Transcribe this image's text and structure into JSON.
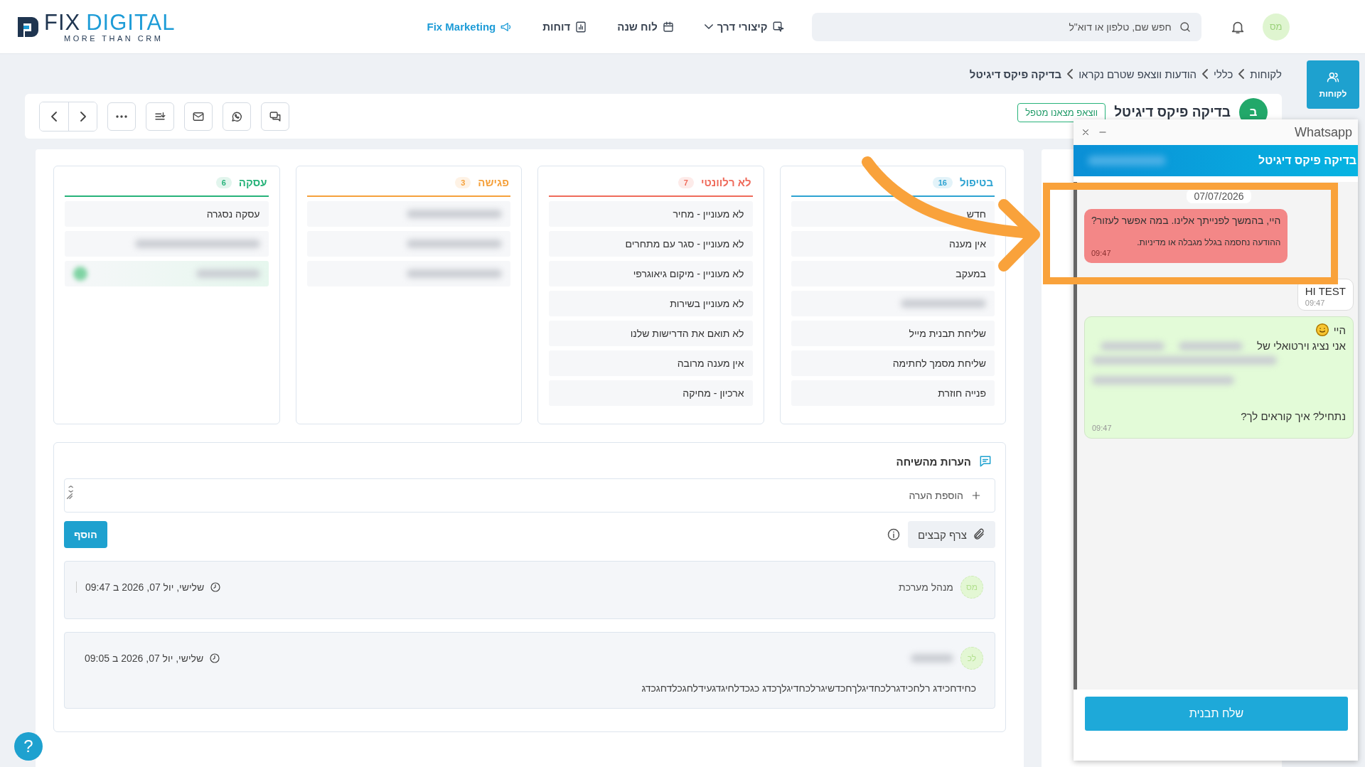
{
  "header": {
    "brand_primary": "FIX",
    "brand_secondary": "DIGITAL",
    "tagline": "MORE THAN CRM",
    "nav": [
      {
        "label": "קיצורי דרך",
        "kind": "shortcuts"
      },
      {
        "label": "לוח שנה",
        "kind": "calendar"
      },
      {
        "label": "דוחות",
        "kind": "reports"
      },
      {
        "label": "Fix Marketing",
        "kind": "marketing"
      }
    ],
    "search": {
      "placeholder": "חפש שם, טלפון או דוא\"ל"
    },
    "user_avatar": "מס"
  },
  "rail": [
    {
      "label": "לקוחות",
      "selected": true
    }
  ],
  "breadcrumb": [
    "לקוחות",
    "כללי",
    "הודעות ווצאפ שטרם נקראו",
    "בדיקה פיקס דיגיטל"
  ],
  "record": {
    "avatar": "ב",
    "name": "בדיקה פיקס דיגיטל",
    "tag": "ווצאפ מצאנו מטפל"
  },
  "pipeline": [
    {
      "title": "בטיפול",
      "count": "16",
      "color": "#2ea3d2",
      "items": [
        {
          "kind": "stage",
          "label": "חדש"
        },
        {
          "kind": "stage",
          "label": "אין מענה"
        },
        {
          "kind": "stage",
          "label": "במעקב"
        },
        {
          "kind": "blurred"
        },
        {
          "kind": "stage",
          "label": "שליחת תבנית מייל"
        },
        {
          "kind": "stage",
          "label": "שליחת מסמך לחתימה"
        },
        {
          "kind": "stage",
          "label": "פנייה חוזרת"
        }
      ]
    },
    {
      "title": "לא רלוונטי",
      "count": "7",
      "color": "#ef6b5b",
      "items": [
        {
          "kind": "stage",
          "label": "לא מעוניין - מחיר"
        },
        {
          "kind": "stage",
          "label": "לא מעוניין - סגר עם מתחרים"
        },
        {
          "kind": "stage",
          "label": "לא מעוניין - מיקום גיאוגרפי"
        },
        {
          "kind": "stage",
          "label": "לא מעוניין בשירות"
        },
        {
          "kind": "stage",
          "label": "לא תואם את הדרישות שלנו"
        },
        {
          "kind": "stage",
          "label": "אין מענה מרובה"
        },
        {
          "kind": "stage",
          "label": "ארכיון - מחיקה"
        }
      ]
    },
    {
      "title": "פגישה",
      "count": "3",
      "color": "#f5a13c",
      "items": [
        {
          "kind": "blurred"
        },
        {
          "kind": "blurred"
        },
        {
          "kind": "blurred"
        }
      ]
    },
    {
      "title": "עסקה",
      "count": "6",
      "color": "#27b37a",
      "items": [
        {
          "kind": "stage",
          "label": "עסקה נסגרה"
        },
        {
          "kind": "blurred"
        },
        {
          "kind": "blurred_marked"
        }
      ]
    }
  ],
  "notes": {
    "title": "הערות מהשיחה",
    "input": {
      "placeholder": "הוספת הערה"
    },
    "attach": "צרף קבצים",
    "add": "הוסף",
    "entries": [
      {
        "avatar": "מס",
        "author": "מנהל מערכת",
        "author_blurred": false,
        "date": "שלישי, יול 07, 2026 ב 09:47"
      },
      {
        "avatar": "לכ",
        "author_blurred": true,
        "date": "שלישי, יול 07, 2026 ב 09:05",
        "body": "כחידחכידג רלחכידגרלכחדיגלךחכדשיגרלכחדיגלךכדג כגכדלחיגדגעידלחגכלדחגכדג"
      }
    ]
  },
  "help": "?",
  "whatsapp": {
    "title": "Whatsapp",
    "contact": "בדיקה פיקס דיגיטל",
    "date": "07/07/2026",
    "messages": [
      {
        "kind": "blocked",
        "text": "היי, בהמשך לפנייתך אלינו. במה אפשר לעזור?",
        "notice": "ההודעה נחסמה בגלל מגבלה או מדיניות.",
        "time": "09:47"
      },
      {
        "kind": "incoming",
        "lines": [
          "HI TEST"
        ],
        "time": "09:47"
      },
      {
        "kind": "bot",
        "greeting": "היי",
        "lines": [
          "אני נציג וירטואלי של"
        ],
        "closing": "נתחיל? איך קוראים לך?",
        "time": "09:47"
      }
    ],
    "send_button": "שלח תבנית"
  }
}
